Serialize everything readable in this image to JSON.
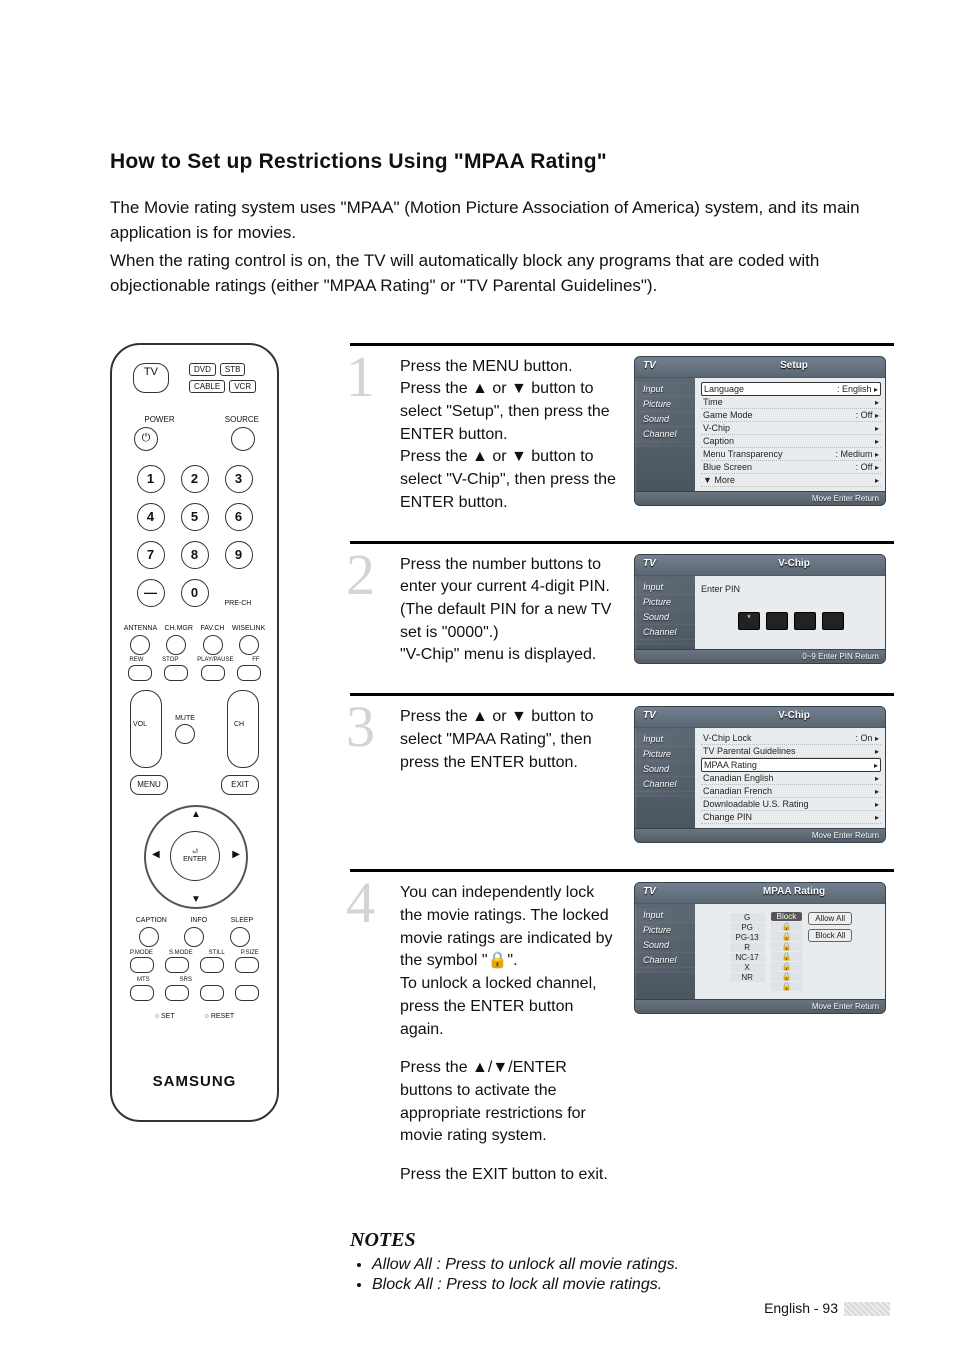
{
  "title": "How to Set up Restrictions Using \"MPAA Rating\"",
  "intro": {
    "p1": "The Movie rating system uses \"MPAA\" (Motion Picture Association of America) system, and its main application is for movies.",
    "p2": "When the rating control is on, the TV will automatically block any programs that are coded with objectionable ratings (either \"MPAA Rating\" or \"TV Parental Guidelines\")."
  },
  "remote": {
    "tv": "TV",
    "dvd": "DVD",
    "stb": "STB",
    "cable": "CABLE",
    "vcr": "VCR",
    "power": "POWER",
    "source": "SOURCE",
    "keys": [
      "1",
      "2",
      "3",
      "4",
      "5",
      "6",
      "7",
      "8",
      "9",
      "—",
      "0"
    ],
    "prech": "PRE-CH",
    "row1": [
      "ANTENNA",
      "CH.MGR",
      "FAV.CH",
      "WISELINK"
    ],
    "row2": [
      "REW",
      "STOP",
      "PLAY/PAUSE",
      "FF"
    ],
    "vol": "VOL",
    "ch": "CH",
    "mute": "MUTE",
    "menu": "MENU",
    "exit": "EXIT",
    "enter": "ENTER",
    "row3": [
      "CAPTION",
      "INFO",
      "SLEEP"
    ],
    "row4": [
      "P.MODE",
      "S.MODE",
      "STILL",
      "P.SIZE"
    ],
    "row5": [
      "MTS",
      "SRS",
      "",
      ""
    ],
    "set": "SET",
    "reset": "RESET",
    "brand": "SAMSUNG"
  },
  "steps": {
    "s1": "Press the MENU button.\nPress the ▲ or ▼ button to select \"Setup\", then press the ENTER button.\nPress the ▲ or ▼ button to select \"V-Chip\", then press the ENTER button.",
    "s2": "Press the number buttons to enter your current 4-digit PIN. (The default PIN for a new TV set is \"0000\".)\n\"V-Chip\" menu is displayed.",
    "s3": "Press the ▲ or ▼ button to select \"MPAA Rating\", then press the ENTER button.",
    "s4a": "You can independently lock the movie ratings. The locked movie ratings are indicated by the symbol \"🔒\".\nTo unlock a locked channel, press the ENTER button again.",
    "s4b": "Press the ▲/▼/ENTER buttons to activate the appropriate restrictions for movie rating system.",
    "s4c": "Press the EXIT button to exit."
  },
  "osd": {
    "sidebar": [
      "Input",
      "Picture",
      "Sound",
      "Channel",
      ""
    ],
    "tv": "TV",
    "screen1": {
      "title": "Setup",
      "rows": [
        {
          "l": "Language",
          "r": ": English",
          "sel": true
        },
        {
          "l": "Time",
          "r": ""
        },
        {
          "l": "Game Mode",
          "r": ": Off"
        },
        {
          "l": "V-Chip",
          "r": ""
        },
        {
          "l": "Caption",
          "r": ""
        },
        {
          "l": "Menu Transparency",
          "r": ": Medium"
        },
        {
          "l": "Blue Screen",
          "r": ": Off"
        },
        {
          "l": "▼ More",
          "r": ""
        }
      ],
      "foot": "Move    Enter    Return"
    },
    "screen2": {
      "title": "V-Chip",
      "label": "Enter PIN",
      "foot": "0~9 Enter PIN    Return"
    },
    "screen3": {
      "title": "V-Chip",
      "rows": [
        {
          "l": "V-Chip Lock",
          "r": ": On"
        },
        {
          "l": "TV Parental Guidelines",
          "r": ""
        },
        {
          "l": "MPAA Rating",
          "r": "",
          "sel": true
        },
        {
          "l": "Canadian English",
          "r": ""
        },
        {
          "l": "Canadian French",
          "r": ""
        },
        {
          "l": "Downloadable U.S. Rating",
          "r": ""
        },
        {
          "l": "Change PIN",
          "r": ""
        }
      ],
      "foot": "Move    Enter    Return"
    },
    "screen4": {
      "title": "MPAA Rating",
      "ratings": [
        "G",
        "PG",
        "PG-13",
        "R",
        "NC-17",
        "X",
        "NR"
      ],
      "block_header": "Block",
      "allow": "Allow All",
      "blockall": "Block All",
      "foot": "Move    Enter    Return"
    }
  },
  "notes": {
    "heading": "NOTES",
    "n1": "Allow All : Press to unlock all movie ratings.",
    "n2": "Block All : Press to lock all movie ratings."
  },
  "footer": "English - 93"
}
